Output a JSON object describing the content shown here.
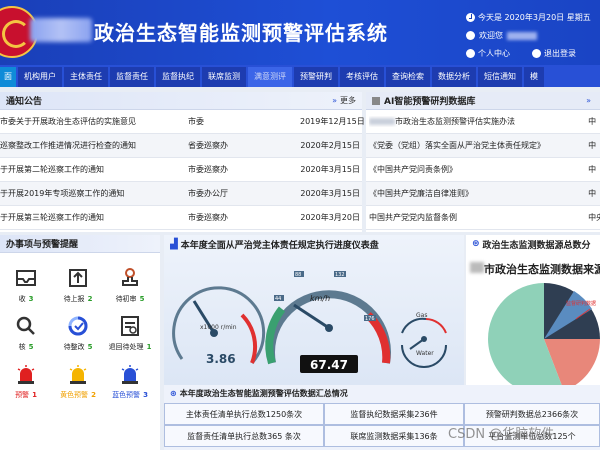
{
  "header": {
    "title": "政治生态智能监测预警评估系统",
    "date": "今天是 2020年3月20日 星期五",
    "welcome": "欢迎您",
    "personal_center": "个人中心",
    "logout": "退出登录"
  },
  "nav": [
    "面",
    "机构用户",
    "主体责任",
    "监督责任",
    "监督执纪",
    "联席监测",
    "满意测评",
    "预警研判",
    "考核评估",
    "查询检索",
    "数据分析",
    "短信通知",
    "模"
  ],
  "notice": {
    "title": "通知公告",
    "more": "更多",
    "rows": [
      {
        "title": "市委关于开展政治生态评估的实施意见",
        "dept": "市委",
        "date": "2019年12月15日"
      },
      {
        "title": "巡察整改工作推进情况进行检查的通知",
        "dept": "省委巡察办",
        "date": "2020年2月15日"
      },
      {
        "title": "于开展第二轮巡察工作的通知",
        "dept": "市委巡察办",
        "date": "2020年3月15日"
      },
      {
        "title": "于开展2019年专项巡察工作的通知",
        "dept": "市委办公厅",
        "date": "2020年3月15日"
      },
      {
        "title": "于开展第三轮巡察工作的通知",
        "dept": "市委巡察办",
        "date": "2020年3月20日"
      }
    ]
  },
  "library": {
    "title": "AI智能预警研判数据库",
    "rows": [
      {
        "name": "市政治生态监测预警评估实施办法",
        "src": "中",
        "blur": true
      },
      {
        "name": "《党委（党组）落实全面从严治党主体责任规定》",
        "src": "中",
        "blur": false
      },
      {
        "name": "《中国共产党问责条例》",
        "src": "中",
        "blur": false
      },
      {
        "name": "《中国共产党廉洁自律准则》",
        "src": "中",
        "blur": false
      },
      {
        "name": "中国共产党党内监督条例",
        "src": "中央",
        "blur": false
      }
    ]
  },
  "todo": {
    "title": "办事项与预警提醒",
    "items": [
      {
        "label": "收",
        "count": "3",
        "icon": "inbox-icon",
        "color": "#2a9d2a"
      },
      {
        "label": "待上报",
        "count": "2",
        "icon": "upload-icon",
        "color": "#2a9d2a"
      },
      {
        "label": "待初审",
        "count": "5",
        "icon": "stamp-icon",
        "color": "#2a9d2a"
      },
      {
        "label": "核",
        "count": "5",
        "icon": "search-icon",
        "color": "#2a9d2a"
      },
      {
        "label": "待整改",
        "count": "5",
        "icon": "progress-icon",
        "color": "#2a9d2a"
      },
      {
        "label": "退回待处理",
        "count": "1",
        "icon": "document-icon",
        "color": "#2a9d2a"
      },
      {
        "label": "预警",
        "count": "1",
        "icon": "red-alarm-icon",
        "color": "#e02020"
      },
      {
        "label": "黄色预警",
        "count": "2",
        "icon": "yellow-alarm-icon",
        "color": "#f0a000"
      },
      {
        "label": "蓝色预警",
        "count": "3",
        "icon": "blue-alarm-icon",
        "color": "#2850d6"
      }
    ]
  },
  "gauges": {
    "title": "本年度全面从严治党主体责任规定执行进度仪表盘",
    "rpm_label": "x1000 r/min",
    "rpm_value": "3.86",
    "speed_unit": "km/h",
    "speed_value": "67.47",
    "speed_ticks": [
      "44",
      "88",
      "132",
      "176",
      "0"
    ],
    "gas_label": "Gas",
    "water_label": "Water",
    "rpm_ticks": [
      "1",
      "2",
      "3",
      "4",
      "5",
      "6",
      "7"
    ]
  },
  "sources": {
    "title": "政治生态监测数据源总数分",
    "subtitle": "市政治生态监测数据来源",
    "legend_label": "监督研判数据"
  },
  "summary": {
    "title": "本年度政治生态智能监测预警评估数据汇总情况",
    "cells": [
      "主体责任清单执行总数1250条次",
      "监督执纪数据采集236件",
      "预警研判数据总2366条次",
      "监督责任清单执行总数365 条次",
      "联席监测数据采集136条",
      "平台监测单位总数125个"
    ]
  },
  "watermark": "CSDN @华脑软件"
}
